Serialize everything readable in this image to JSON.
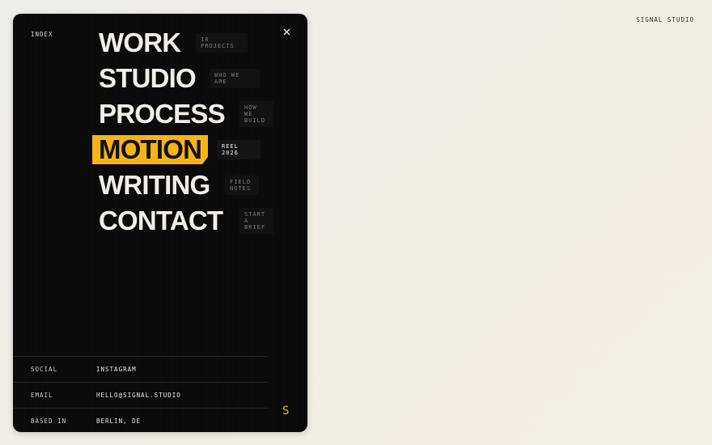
{
  "header": {
    "brand": "SIGNAL STUDIO"
  },
  "menu": {
    "index_label": "INDEX",
    "close_icon": "close-icon",
    "items": [
      {
        "label": "WORK",
        "note": "18 PROJECTS",
        "active": false
      },
      {
        "label": "STUDIO",
        "note": "WHO WE ARE",
        "active": false
      },
      {
        "label": "PROCESS",
        "note": "HOW WE BUILD",
        "active": false
      },
      {
        "label": "MOTION",
        "note": "REEL 2026",
        "active": true
      },
      {
        "label": "WRITING",
        "note": "FIELD NOTES",
        "active": false
      },
      {
        "label": "CONTACT",
        "note": "START A BRIEF",
        "active": false
      }
    ],
    "info": [
      {
        "key": "SOCIAL",
        "value": "INSTAGRAM"
      },
      {
        "key": "EMAIL",
        "value": "HELLO@SIGNAL.STUDIO"
      },
      {
        "key": "BASED IN",
        "value": "BERLIN, DE"
      }
    ],
    "mark": "S"
  },
  "colors": {
    "accent": "#f6b418",
    "panel": "#0b0b0c",
    "background": "#f1eee6"
  }
}
